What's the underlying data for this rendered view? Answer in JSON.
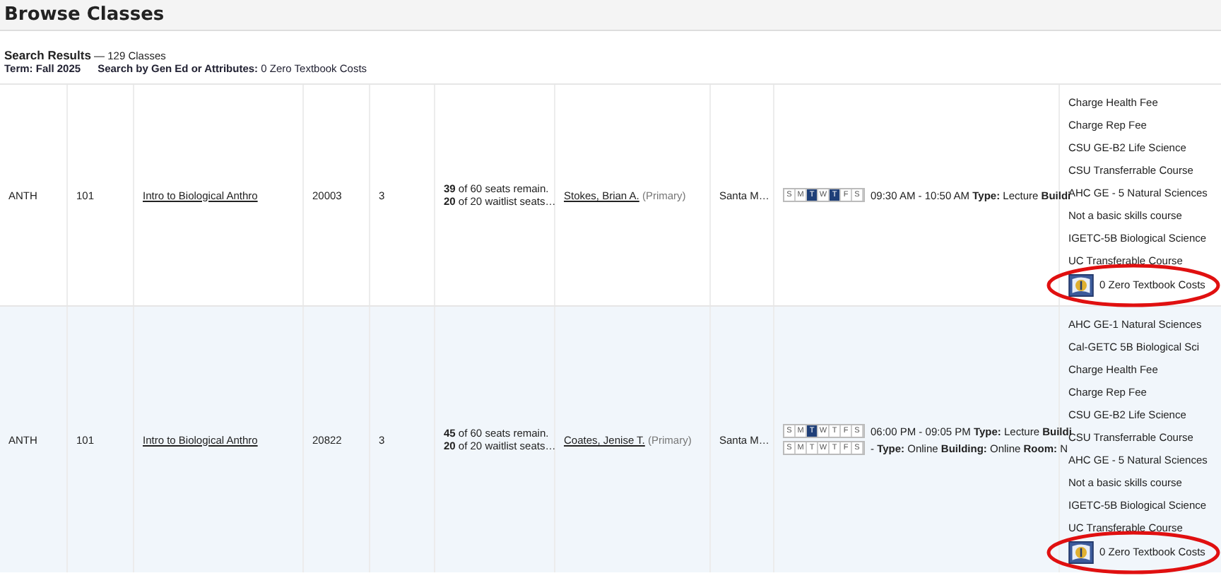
{
  "page_title": "Browse Classes",
  "summary": {
    "label": "Search Results",
    "count": "— 129 Classes",
    "term_label": "Term:",
    "term": "Fall 2025",
    "filter_label": "Search by Gen Ed or Attributes:",
    "filter": "0 Zero Textbook Costs"
  },
  "rows": [
    {
      "subject": "ANTH",
      "course": "101",
      "title": "Intro to Biological Anthro",
      "crn": "20003",
      "units": "3",
      "seats": "**39** of 60 seats remain.",
      "waitlist": "**20** of 20 waitlist seats…",
      "instructor": "Stokes, Brian A.",
      "role": "(Primary)",
      "campus": "Santa M…",
      "meetings": [
        {
          "days": [
            {
              "letter": "S",
              "selected": false
            },
            {
              "letter": "M",
              "selected": false
            },
            {
              "letter": "T",
              "selected": true
            },
            {
              "letter": "W",
              "selected": false
            },
            {
              "letter": "T",
              "selected": true
            },
            {
              "letter": "F",
              "selected": false
            },
            {
              "letter": "S",
              "selected": false
            }
          ],
          "text": "09:30 AM - 10:50 AM **Type:** Lecture **Buildi**"
        }
      ],
      "attributes": [
        {
          "label": "Charge Health Fee",
          "kind": "text"
        },
        {
          "label": "Charge Rep Fee",
          "kind": "text"
        },
        {
          "label": "CSU GE-B2 Life Science",
          "kind": "text"
        },
        {
          "label": "CSU Transferrable Course",
          "kind": "text"
        },
        {
          "label": "AHC GE - 5 Natural Sciences",
          "kind": "text"
        },
        {
          "label": "Not a basic skills course",
          "kind": "text"
        },
        {
          "label": "IGETC-5B Biological Science",
          "kind": "text"
        },
        {
          "label": "UC Transferable Course",
          "kind": "text"
        },
        {
          "label": "0 Zero Textbook Costs",
          "kind": "badge"
        }
      ]
    },
    {
      "subject": "ANTH",
      "course": "101",
      "title": "Intro to Biological Anthro",
      "crn": "20822",
      "units": "3",
      "seats": "**45** of 60 seats remain.",
      "waitlist": "**20** of 20 waitlist seats…",
      "instructor": "Coates, Jenise T.",
      "role": "(Primary)",
      "campus": "Santa M…",
      "meetings": [
        {
          "days": [
            {
              "letter": "S",
              "selected": false
            },
            {
              "letter": "M",
              "selected": false
            },
            {
              "letter": "T",
              "selected": true
            },
            {
              "letter": "W",
              "selected": false
            },
            {
              "letter": "T",
              "selected": false
            },
            {
              "letter": "F",
              "selected": false
            },
            {
              "letter": "S",
              "selected": false
            }
          ],
          "text": "06:00 PM - 09:05 PM **Type:** Lecture **Buildi**"
        },
        {
          "days": [
            {
              "letter": "S",
              "selected": false
            },
            {
              "letter": "M",
              "selected": false
            },
            {
              "letter": "T",
              "selected": false
            },
            {
              "letter": "W",
              "selected": false
            },
            {
              "letter": "T",
              "selected": false
            },
            {
              "letter": "F",
              "selected": false
            },
            {
              "letter": "S",
              "selected": false
            }
          ],
          "text": "- **Type:** Online **Building:** Online **Room:** N"
        }
      ],
      "attributes": [
        {
          "label": "AHC GE-1 Natural Sciences",
          "kind": "text"
        },
        {
          "label": "Cal-GETC 5B Biological Sci",
          "kind": "text"
        },
        {
          "label": "Charge Health Fee",
          "kind": "text"
        },
        {
          "label": "Charge Rep Fee",
          "kind": "text"
        },
        {
          "label": "CSU GE-B2 Life Science",
          "kind": "text"
        },
        {
          "label": "CSU Transferrable Course",
          "kind": "text"
        },
        {
          "label": "AHC GE - 5 Natural Sciences",
          "kind": "text"
        },
        {
          "label": "Not a basic skills course",
          "kind": "text"
        },
        {
          "label": "IGETC-5B Biological Science",
          "kind": "text"
        },
        {
          "label": "UC Transferable Course",
          "kind": "text"
        },
        {
          "label": "0 Zero Textbook Costs",
          "kind": "badge"
        }
      ]
    }
  ]
}
